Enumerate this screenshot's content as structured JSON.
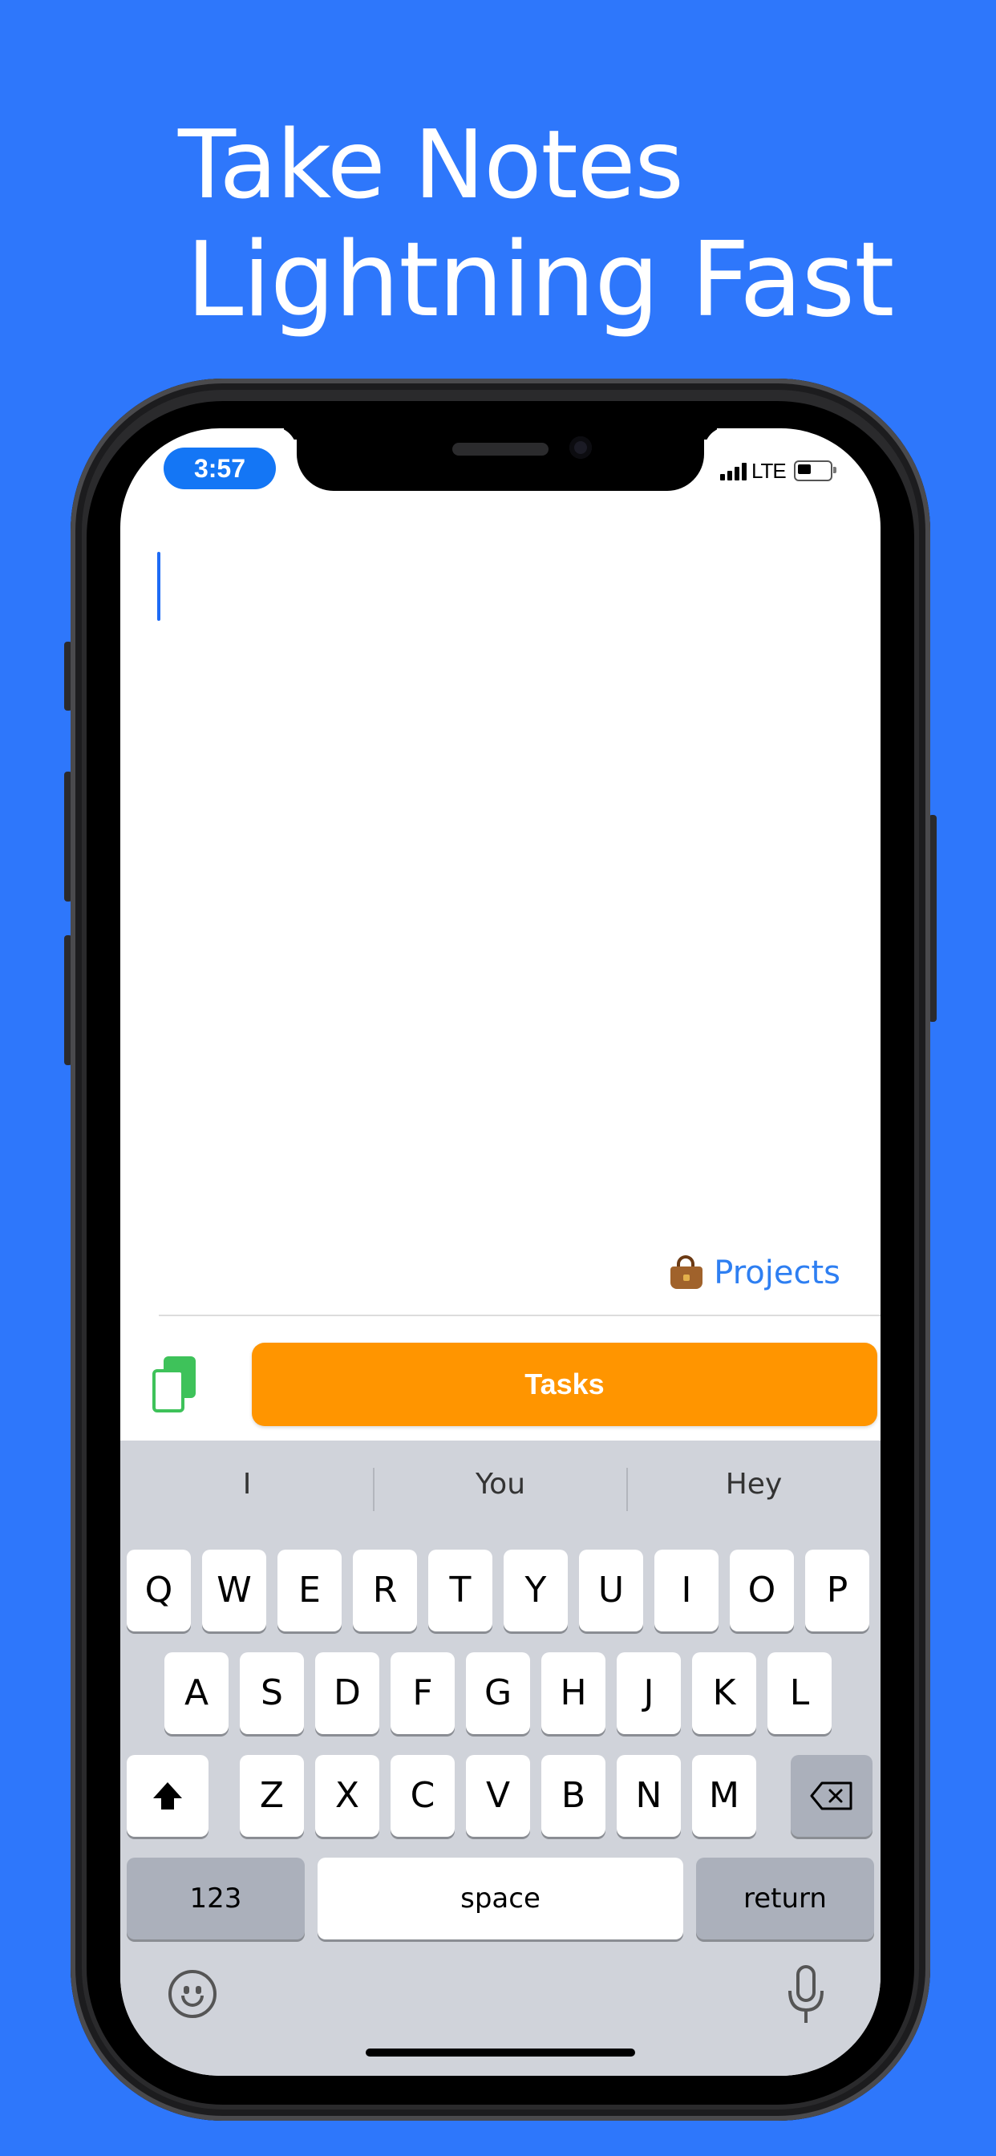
{
  "headline": {
    "line1": "Take Notes",
    "line2": "Lightning Fast"
  },
  "status_bar": {
    "time": "3:57",
    "network": "LTE"
  },
  "editor": {
    "projects_label": "Projects",
    "tasks_button_label": "Tasks"
  },
  "keyboard": {
    "suggestions": [
      "I",
      "You",
      "Hey"
    ],
    "row1": [
      "Q",
      "W",
      "E",
      "R",
      "T",
      "Y",
      "U",
      "I",
      "O",
      "P"
    ],
    "row2": [
      "A",
      "S",
      "D",
      "F",
      "G",
      "H",
      "J",
      "K",
      "L"
    ],
    "row3": [
      "Z",
      "X",
      "C",
      "V",
      "B",
      "N",
      "M"
    ],
    "numbers_label": "123",
    "space_label": "space",
    "return_label": "return"
  },
  "colors": {
    "background": "#2e77fb",
    "accent_orange": "#ff9500",
    "link_blue": "#2e7ff2",
    "time_pill": "#1476f5",
    "icon_green": "#3ec25a"
  },
  "icons": [
    "bag-icon",
    "copy-icon",
    "shift-icon",
    "delete-icon",
    "emoji-icon",
    "mic-icon"
  ]
}
